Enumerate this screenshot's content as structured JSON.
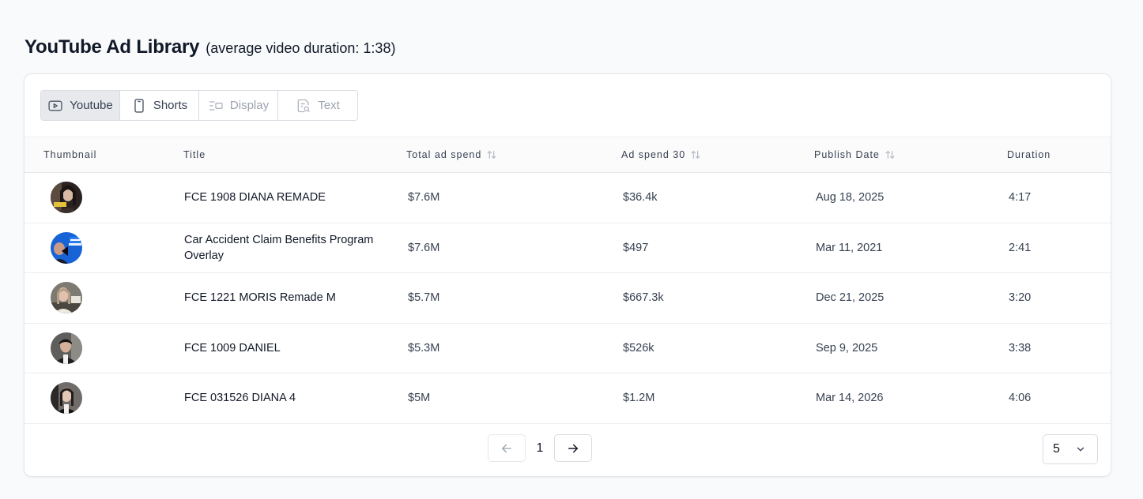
{
  "header": {
    "title": "YouTube Ad Library",
    "subtitle": "(average video duration: 1:38)"
  },
  "tabs": [
    {
      "label": "Youtube",
      "icon": "video-play-icon",
      "state": "active"
    },
    {
      "label": "Shorts",
      "icon": "phone-icon",
      "state": "enabled"
    },
    {
      "label": "Display",
      "icon": "display-layout-icon",
      "state": "disabled"
    },
    {
      "label": "Text",
      "icon": "text-search-icon",
      "state": "disabled"
    }
  ],
  "table": {
    "columns": {
      "thumbnail": "Thumbnail",
      "title": "Title",
      "total_ad_spend": "Total ad spend",
      "ad_spend_30": "Ad spend 30",
      "publish_date": "Publish Date",
      "duration": "Duration"
    },
    "rows": [
      {
        "title": "FCE 1908 DIANA REMADE",
        "total": "$7.6M",
        "spend30": "$36.4k",
        "date": "Aug 18, 2025",
        "duration": "4:17"
      },
      {
        "title": "Car Accident Claim Benefits Program Overlay",
        "total": "$7.6M",
        "spend30": "$497",
        "date": "Mar 11, 2021",
        "duration": "2:41"
      },
      {
        "title": "FCE 1221 MORIS Remade M",
        "total": "$5.7M",
        "spend30": "$667.3k",
        "date": "Dec 21, 2025",
        "duration": "3:20"
      },
      {
        "title": "FCE 1009 DANIEL",
        "total": "$5.3M",
        "spend30": "$526k",
        "date": "Sep 9, 2025",
        "duration": "3:38"
      },
      {
        "title": "FCE 031526 DIANA 4",
        "total": "$5M",
        "spend30": "$1.2M",
        "date": "Mar 14, 2026",
        "duration": "4:06"
      }
    ]
  },
  "pagination": {
    "current_page": "1",
    "per_page": "5"
  },
  "colors": {
    "accent_tab_bg": "#e7e9ed",
    "border": "#d9dce1",
    "text": "#111827",
    "muted": "#9ca3af"
  }
}
